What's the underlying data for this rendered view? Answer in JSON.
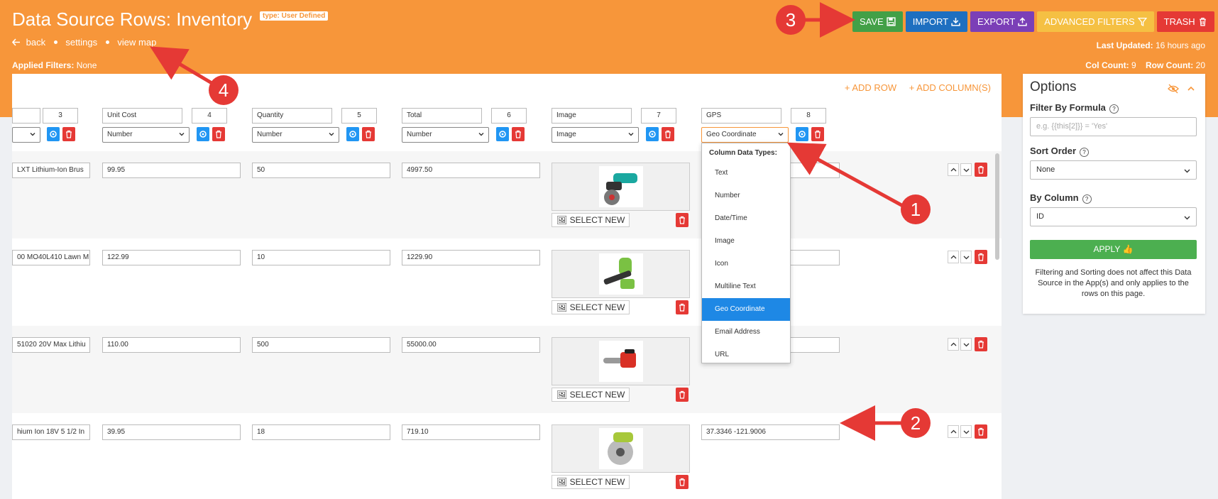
{
  "header": {
    "title": "Data Source Rows: Inventory",
    "type_badge": "type: User Defined",
    "crumbs": {
      "back": "back",
      "settings": "settings",
      "view_map": "view map"
    },
    "applied_label": "Applied Filters:",
    "applied_value": "None",
    "last_updated_label": "Last Updated:",
    "last_updated_value": "16 hours ago",
    "col_count_label": "Col Count:",
    "col_count_value": "9",
    "row_count_label": "Row Count:",
    "row_count_value": "20"
  },
  "toolbar": {
    "save": "SAVE",
    "import": "IMPORT",
    "export": "EXPORT",
    "advanced_filters": "ADVANCED FILTERS",
    "trash": "TRASH"
  },
  "colors": {
    "header": "#f7963a",
    "save": "#43a047",
    "import": "#1e6fc0",
    "export": "#7b3fb7",
    "advanced": "#f5c043",
    "trash": "#e53935",
    "gear": "#2196f3",
    "selected_option": "#1e88e5",
    "callout": "#e53935"
  },
  "add_links": {
    "add_row": "+ ADD ROW",
    "add_columns": "+ ADD COLUMN(S)"
  },
  "columns": [
    {
      "name": "",
      "index": "3",
      "type": ""
    },
    {
      "name": "Unit Cost",
      "index": "4",
      "type": "Number"
    },
    {
      "name": "Quantity",
      "index": "5",
      "type": "Number"
    },
    {
      "name": "Total",
      "index": "6",
      "type": "Number"
    },
    {
      "name": "Image",
      "index": "7",
      "type": "Image"
    },
    {
      "name": "GPS",
      "index": "8",
      "type": "Geo Coordinate"
    }
  ],
  "rows": [
    {
      "name": "LXT Lithium-Ion Brus",
      "unit_cost": "99.95",
      "quantity": "50",
      "total": "4997.50",
      "gps": ""
    },
    {
      "name": "00 MO40L410 Lawn M",
      "unit_cost": "122.99",
      "quantity": "10",
      "total": "1229.90",
      "gps": ""
    },
    {
      "name": "51020 20V Max Lithiu",
      "unit_cost": "110.00",
      "quantity": "500",
      "total": "55000.00",
      "gps": ""
    },
    {
      "name": "hium Ion 18V 5 1/2 In",
      "unit_cost": "39.95",
      "quantity": "18",
      "total": "719.10",
      "gps": "37.3346 -121.9006"
    }
  ],
  "select_new": "SELECT NEW",
  "dropdown": {
    "header": "Column Data Types:",
    "options": [
      "Text",
      "Number",
      "Date/Time",
      "Image",
      "Icon",
      "Multiline Text",
      "Geo Coordinate",
      "Email Address",
      "URL"
    ],
    "selected": "Geo Coordinate"
  },
  "options_panel": {
    "title": "Options",
    "filter_label": "Filter By Formula",
    "filter_placeholder": "e.g. {{this[2]}} = 'Yes'",
    "sort_label": "Sort Order",
    "sort_value": "None",
    "by_column_label": "By Column",
    "by_column_value": "ID",
    "apply": "APPLY",
    "note": "Filtering and Sorting does not affect this Data Source in the App(s) and only applies to the rows on this page."
  },
  "callouts": [
    "1",
    "2",
    "3",
    "4"
  ]
}
